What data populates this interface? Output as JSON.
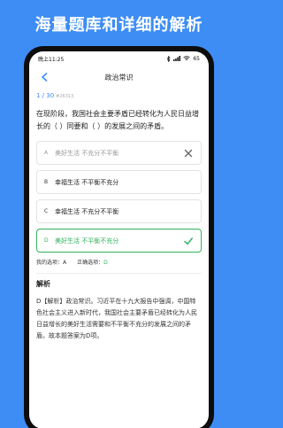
{
  "promo": {
    "title": "海量题库和详细的解析"
  },
  "status_bar": {
    "time": "晚上11:25",
    "battery": "65"
  },
  "nav": {
    "title": "政治常识"
  },
  "progress": {
    "text": "1 / 30",
    "question_id": "#26313"
  },
  "question": {
    "text": "在现阶段，我国社会主要矛盾已经转化为人民日益增长的（ ）同要和（ ）的发展之间的矛盾。"
  },
  "options": [
    {
      "letter": "A",
      "text": "美好生活  不充分不平衡",
      "state": "wrong"
    },
    {
      "letter": "B",
      "text": "幸福生活  不平衡不充分",
      "state": "normal"
    },
    {
      "letter": "C",
      "text": "幸福生活  不充分不平衡",
      "state": "normal"
    },
    {
      "letter": "D",
      "text": "美好生活  不平衡不充分",
      "state": "correct"
    }
  ],
  "answers": {
    "my_label": "我的选项：",
    "my_value": "A",
    "correct_label": "正确选项：",
    "correct_value": "D"
  },
  "explanation": {
    "heading": "解析",
    "body": "D【解析】政治常识。习近平在十九大报告中强调，中国特色社会主义进入新时代，我国社会主要矛盾已经转化为人民日益增长的美好生活需要和不平衡不充分的发展之间的矛盾。故本题答案为D项。"
  },
  "colors": {
    "brand": "#3d8df5",
    "correct": "#2fb25b",
    "wrong": "#999999"
  },
  "icons": {
    "back": "chevron-left-icon",
    "wrong": "close-icon",
    "correct": "check-icon"
  }
}
